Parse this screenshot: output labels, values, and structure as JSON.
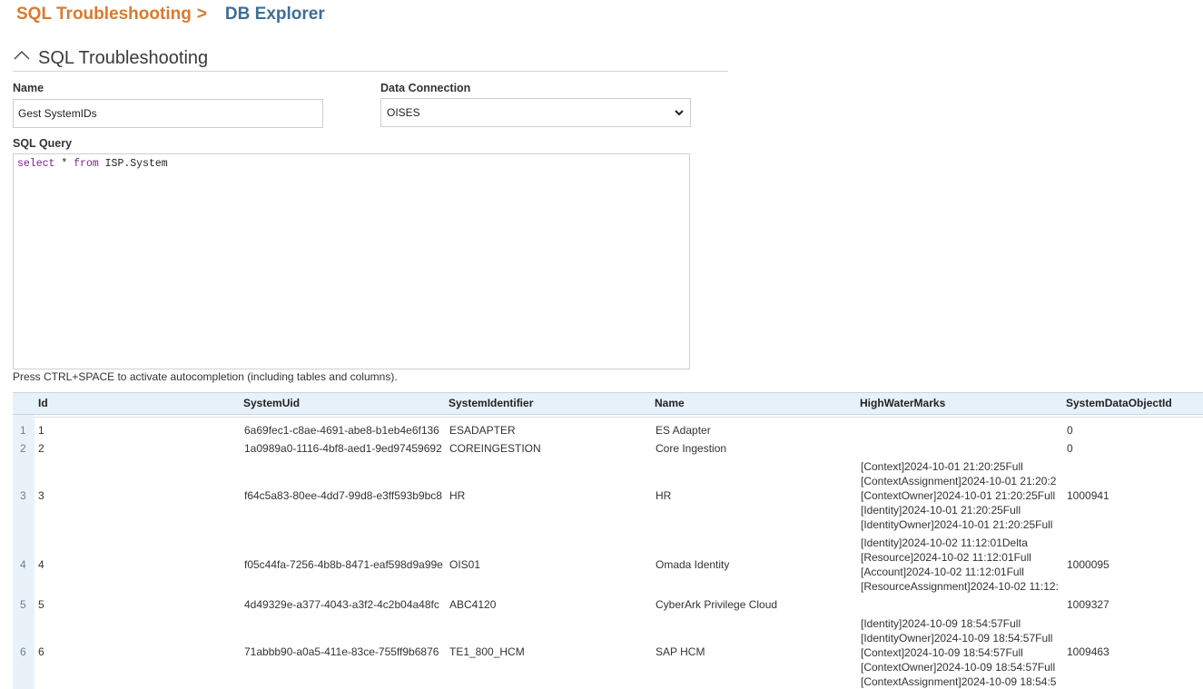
{
  "breadcrumb": {
    "parent": "SQL Troubleshooting",
    "separator": ">",
    "current": "DB Explorer"
  },
  "section": {
    "title": "SQL Troubleshooting",
    "icon": "caret-up-icon"
  },
  "form": {
    "name_label": "Name",
    "name_value": "Gest SystemIDs",
    "connection_label": "Data Connection",
    "connection_value": "OISES",
    "query_label": "SQL Query",
    "query_tokens": {
      "kw1": "select",
      "star": " * ",
      "kw2": "from",
      "rest": " ISP.System"
    },
    "hint": "Press CTRL+SPACE to activate autocompletion (including tables and columns)."
  },
  "grid": {
    "columns": [
      "Id",
      "SystemUid",
      "SystemIdentifier",
      "Name",
      "HighWaterMarks",
      "SystemDataObjectId"
    ],
    "rows": [
      {
        "num": "1",
        "id": "1",
        "uid": "6a69fec1-c8ae-4691-abe8-b1eb4e6f136",
        "identifier": "ESADAPTER",
        "name": "ES Adapter",
        "hwm": [],
        "sdoid": "0"
      },
      {
        "num": "2",
        "id": "2",
        "uid": "1a0989a0-1116-4bf8-aed1-9ed97459692",
        "identifier": "COREINGESTION",
        "name": "Core Ingestion",
        "hwm": [],
        "sdoid": "0"
      },
      {
        "num": "3",
        "id": "3",
        "uid": "f64c5a83-80ee-4dd7-99d8-e3ff593b9bc8",
        "identifier": "HR",
        "name": "HR",
        "hwm": [
          "[Context]2024-10-01 21:20:25Full",
          "[ContextAssignment]2024-10-01 21:20:2",
          "[ContextOwner]2024-10-01 21:20:25Full",
          "[Identity]2024-10-01 21:20:25Full",
          "[IdentityOwner]2024-10-01 21:20:25Full"
        ],
        "sdoid": "1000941"
      },
      {
        "num": "4",
        "id": "4",
        "uid": "f05c44fa-7256-4b8b-8471-eaf598d9a99e",
        "identifier": "OIS01",
        "name": "Omada Identity",
        "hwm": [
          "[Identity]2024-10-02 11:12:01Delta",
          "[Resource]2024-10-02 11:12:01Full",
          "[Account]2024-10-02 11:12:01Full",
          "[ResourceAssignment]2024-10-02 11:12:"
        ],
        "sdoid": "1000095"
      },
      {
        "num": "5",
        "id": "5",
        "uid": "4d49329e-a377-4043-a3f2-4c2b04a48fc",
        "identifier": "ABC4120",
        "name": "CyberArk Privilege Cloud",
        "hwm": [],
        "sdoid": "1009327"
      },
      {
        "num": "6",
        "id": "6",
        "uid": "71abbb90-a0a5-411e-83ce-755ff9b6876",
        "identifier": "TE1_800_HCM",
        "name": "SAP HCM",
        "hwm": [
          "[Identity]2024-10-09 18:54:57Full",
          "[IdentityOwner]2024-10-09 18:54:57Full",
          "[Context]2024-10-09 18:54:57Full",
          "[ContextOwner]2024-10-09 18:54:57Full",
          "[ContextAssignment]2024-10-09 18:54:5"
        ],
        "sdoid": "1009463"
      }
    ]
  },
  "colors": {
    "breadcrumb_parent": "#d9792e",
    "breadcrumb_current": "#3c6e96",
    "sql_keyword": "#7a1f8f",
    "grid_header_bg": "#e7f1fa"
  }
}
